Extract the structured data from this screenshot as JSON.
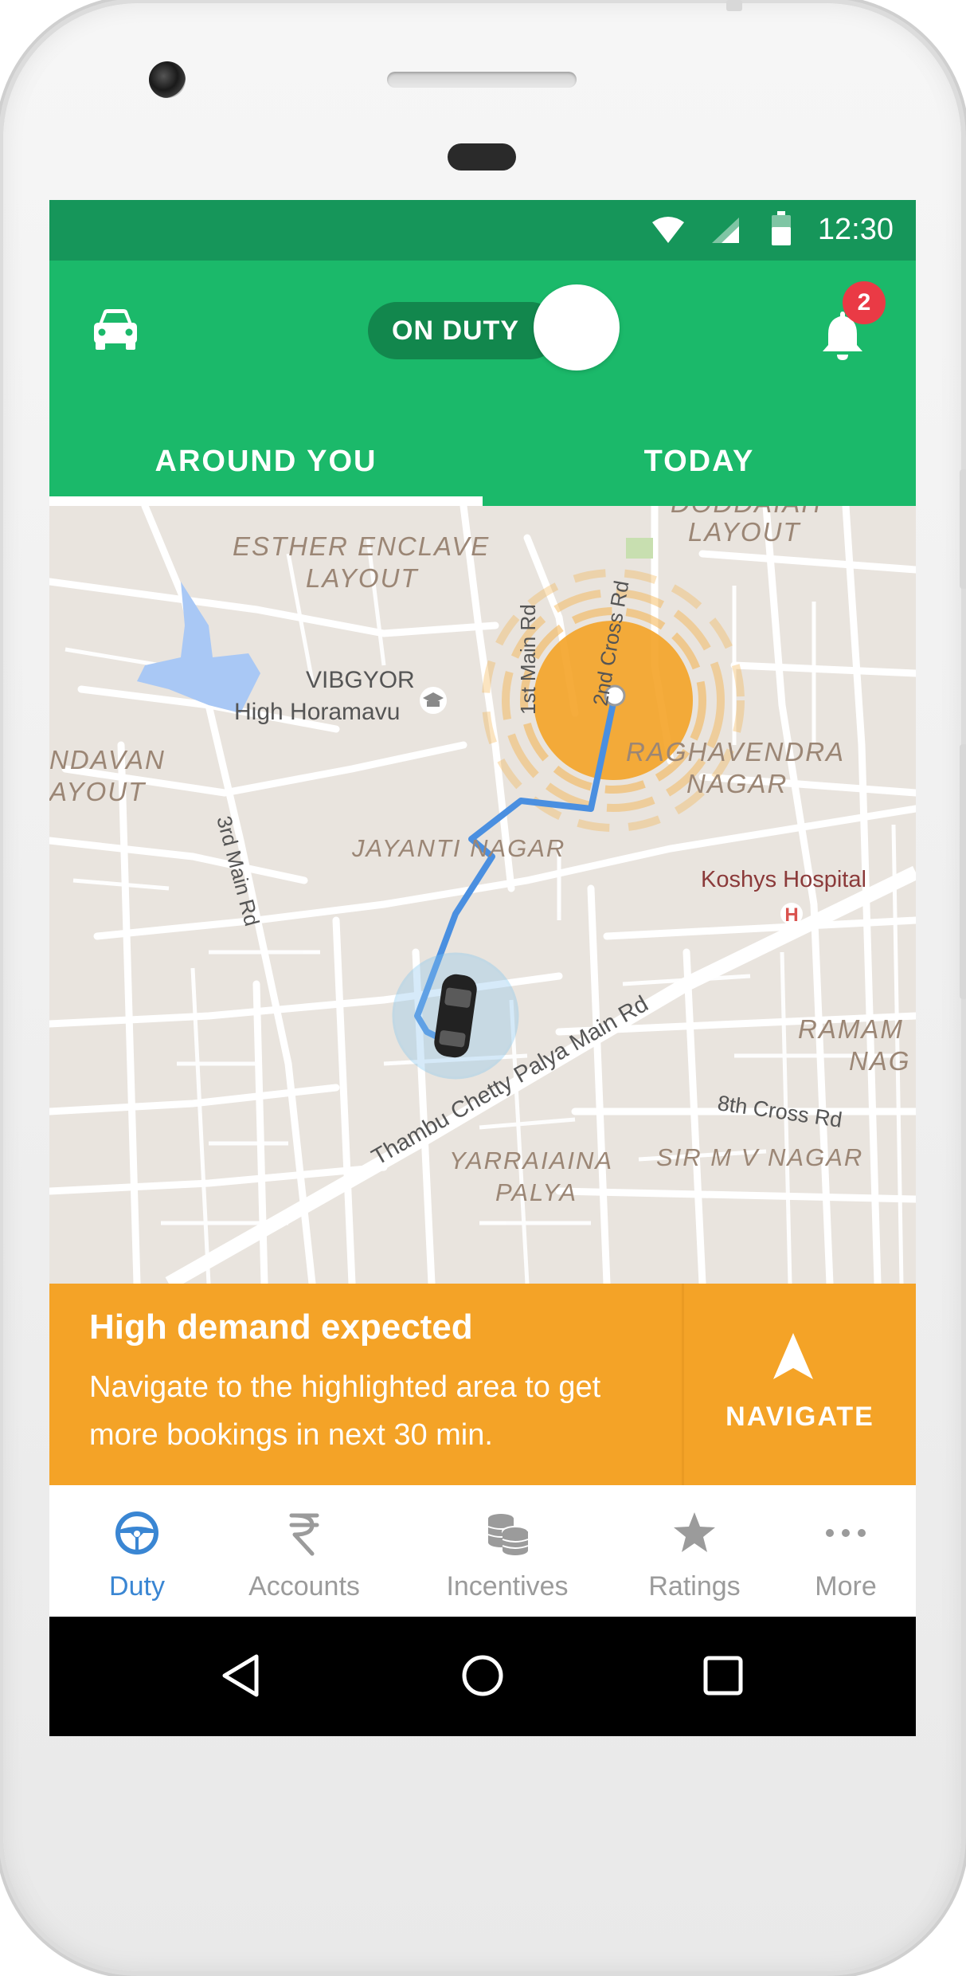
{
  "status_bar": {
    "time": "12:30"
  },
  "app_bar": {
    "duty_toggle_label": "ON DUTY",
    "notification_count": "2"
  },
  "tabs": [
    {
      "label": "AROUND YOU",
      "active": true
    },
    {
      "label": "TODAY",
      "active": false
    }
  ],
  "map": {
    "labels": {
      "esther_1": "ESTHER ENCLAVE",
      "esther_2": "LAYOUT",
      "doddaiah_1": "DODDAIAH",
      "doddaiah_2": "LAYOUT",
      "vibgyor_1": "VIBGYOR",
      "vibgyor_2": "High Horamavu",
      "ndavan_1": "NDAVAN",
      "ndavan_2": "AYOUT",
      "first_main": "1st Main Rd",
      "second_cross": "2nd Cross Rd",
      "raghavendra_1": "RAGHAVENDRA",
      "raghavendra_2": "NAGAR",
      "third_main": "3rd Main Rd",
      "jayanti": "JAYANTI NAGAR",
      "koshys": "Koshys Hospital",
      "thambu": "Thambu Chetty Palya Main Rd",
      "ramam_1": "RAMAM",
      "ramam_2": "NAG",
      "eighth_cross": "8th Cross Rd",
      "sir_mv": "SIR M V NAGAR",
      "yarraiaina_1": "YARRAIAINA",
      "yarraiaina_2": "PALYA"
    }
  },
  "demand_banner": {
    "title": "High demand expected",
    "message": "Navigate to the highlighted area to get more bookings in next 30 min.",
    "action_label": "NAVIGATE"
  },
  "bottom_nav": [
    {
      "label": "Duty",
      "icon": "steering-wheel-icon",
      "active": true
    },
    {
      "label": "Accounts",
      "icon": "rupee-icon",
      "active": false
    },
    {
      "label": "Incentives",
      "icon": "coins-icon",
      "active": false
    },
    {
      "label": "Ratings",
      "icon": "star-icon",
      "active": false
    },
    {
      "label": "More",
      "icon": "more-dots-icon",
      "active": false
    }
  ],
  "colors": {
    "status_bar": "#16965a",
    "app_bar": "#1bb96a",
    "banner": "#f4a327",
    "route": "#4a8fe0",
    "active_nav": "#3a86d3"
  }
}
